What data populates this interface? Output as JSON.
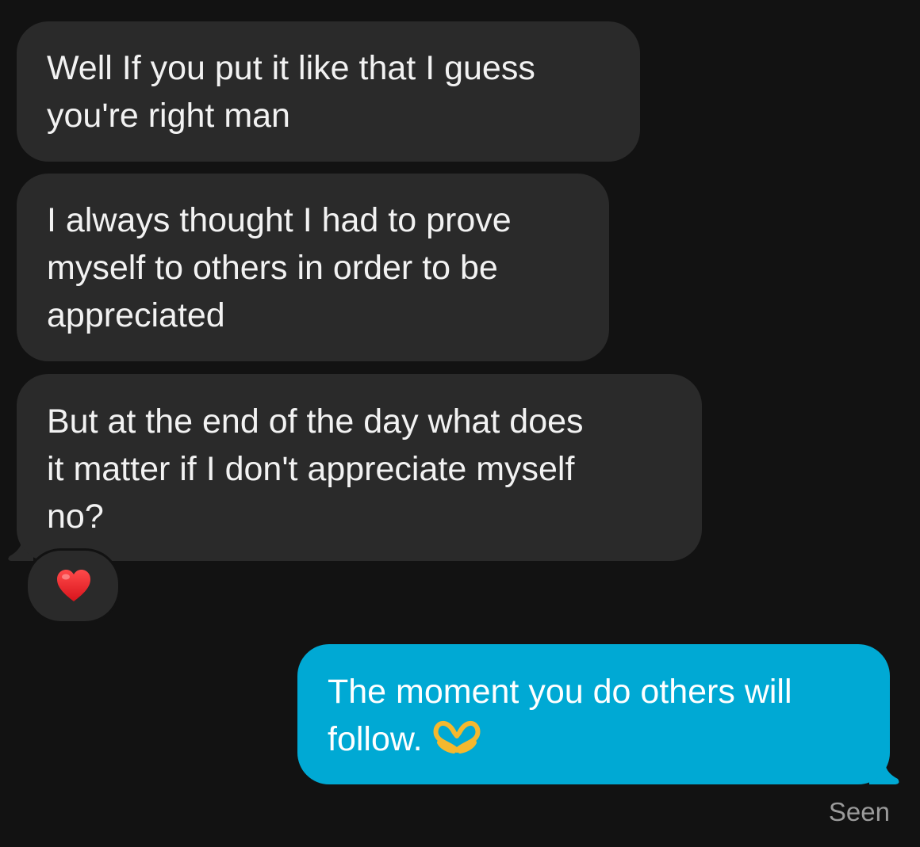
{
  "messages": [
    {
      "direction": "incoming",
      "text": "Well If you put it like that I guess\nyou're right man"
    },
    {
      "direction": "incoming",
      "text": "I always thought I had to prove\nmyself to others in order to be\nappreciated"
    },
    {
      "direction": "incoming",
      "text": "But at the end of the day what does\nit matter if I don't appreciate myself\nno?",
      "reaction": "red-heart"
    },
    {
      "direction": "outgoing",
      "text": "The moment you do others will\nfollow.",
      "trailing_emoji": "heart-hands"
    }
  ],
  "status": "Seen",
  "colors": {
    "background": "#121212",
    "incoming_bubble": "#2a2a2a",
    "outgoing_bubble": "#00a9d4",
    "status_text": "#9a9a9a"
  }
}
